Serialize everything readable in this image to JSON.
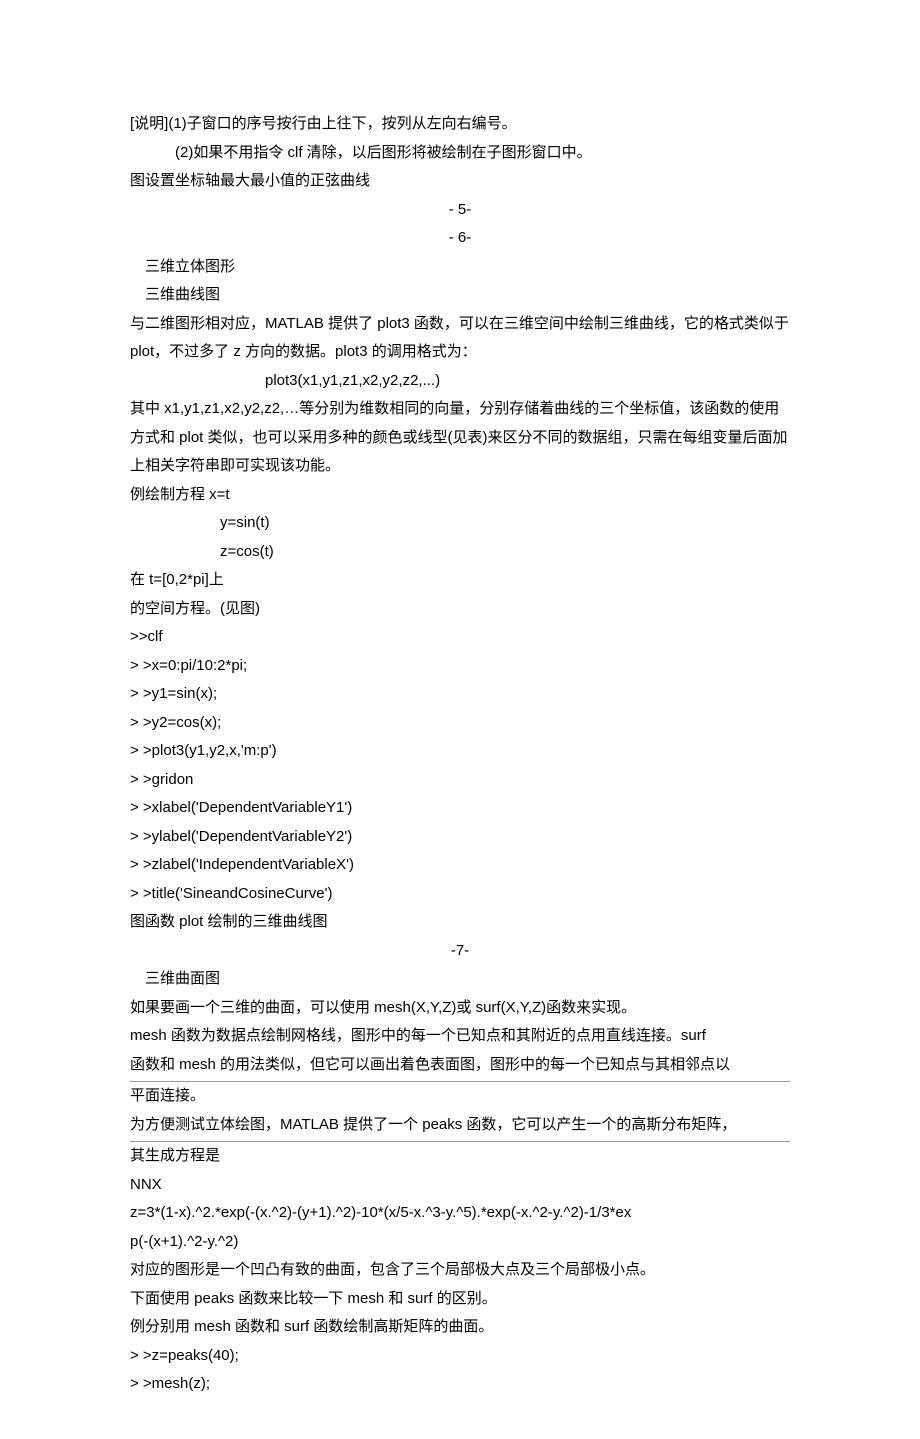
{
  "p01": "[说明](1)子窗口的序号按行由上往下，按列从左向右编号。",
  "p02": "(2)如果不用指令 clf 清除，以后图形将被绘制在子图形窗口中。",
  "p03": "图设置坐标轴最大最小值的正弦曲线",
  "p04": "- 5-",
  "p05": "- 6-",
  "p06": "三维立体图形",
  "p07": "三维曲线图",
  "p08": "与二维图形相对应，MATLAB 提供了 plot3 函数，可以在三维空间中绘制三维曲线，它的格式类似于 plot，不过多了 z 方向的数据。plot3 的调用格式为：",
  "p09": "plot3(x1,y1,z1,x2,y2,z2,...)",
  "p10": "其中 x1,y1,z1,x2,y2,z2,…等分别为维数相同的向量，分别存储着曲线的三个坐标值，该函数的使用方式和 plot 类似，也可以采用多种的颜色或线型(见表)来区分不同的数据组，只需在每组变量后面加上相关字符串即可实现该功能。",
  "p11": "例绘制方程 x=t",
  "p12": "y=sin(t)",
  "p13": "z=cos(t)",
  "p14": "在 t=[0,2*pi]上",
  "p15": "的空间方程。(见图)",
  "p16": ">>clf",
  "p17": ">  >x=0:pi/10:2*pi;",
  "p18": ">  >y1=sin(x);",
  "p19": ">  >y2=cos(x);",
  "p20": ">  >plot3(y1,y2,x,'m:p')",
  "p21": ">  >gridon",
  "p22": ">  >xlabel('DependentVariableY1')",
  "p23": ">  >ylabel('DependentVariableY2')",
  "p24": ">  >zlabel('IndependentVariableX')",
  "p25": ">  >title('SineandCosineCurve')",
  "p26": "图函数 plot 绘制的三维曲线图",
  "p27": "-7-",
  "p28": "三维曲面图",
  "p29": "如果要画一个三维的曲面，可以使用 mesh(X,Y,Z)或 surf(X,Y,Z)函数来实现。",
  "p30": "mesh 函数为数据点绘制网格线，图形中的每一个已知点和其附近的点用直线连接。surf",
  "p31": "函数和 mesh 的用法类似，但它可以画出着色表面图，图形中的每一个已知点与其相邻点以",
  "p32": "平面连接。",
  "p33": "为方便测试立体绘图，MATLAB 提供了一个 peaks 函数，它可以产生一个的高斯分布矩阵，",
  "p34": "其生成方程是",
  "p35": "NNX",
  "p36": "z=3*(1-x).^2.*exp(-(x.^2)-(y+1).^2)-10*(x/5-x.^3-y.^5).*exp(-x.^2-y.^2)-1/3*ex",
  "p37": "p(-(x+1).^2-y.^2)",
  "p38": "对应的图形是一个凹凸有致的曲面，包含了三个局部极大点及三个局部极小点。",
  "p39": "下面使用 peaks 函数来比较一下 mesh 和 surf 的区别。",
  "p40": "例分别用 mesh 函数和 surf 函数绘制高斯矩阵的曲面。",
  "p41": ">  >z=peaks(40);",
  "p42": ">  >mesh(z);"
}
